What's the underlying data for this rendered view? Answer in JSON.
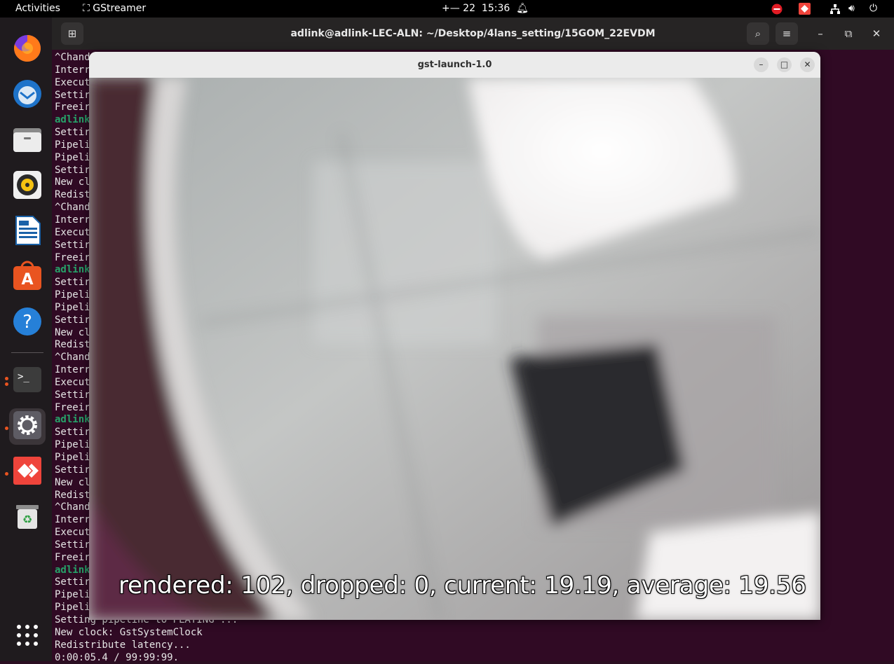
{
  "topbar": {
    "activities": "Activities",
    "app_name": "GStreamer",
    "clock_date": "+— 22",
    "clock_time": "15:36"
  },
  "dock": {
    "items": [
      {
        "name": "Firefox",
        "icon": "firefox-icon"
      },
      {
        "name": "Thunderbird",
        "icon": "thunderbird-icon"
      },
      {
        "name": "Files",
        "icon": "files-icon"
      },
      {
        "name": "Rhythmbox",
        "icon": "rhythmbox-icon"
      },
      {
        "name": "LibreOffice Writer",
        "icon": "writer-icon"
      },
      {
        "name": "Ubuntu Software",
        "icon": "software-icon"
      },
      {
        "name": "Help",
        "icon": "help-icon"
      },
      {
        "name": "Terminal",
        "icon": "terminal-icon"
      },
      {
        "name": "Settings",
        "icon": "settings-icon"
      },
      {
        "name": "AnyDesk",
        "icon": "anydesk-icon"
      },
      {
        "name": "Trash",
        "icon": "trash-icon"
      }
    ]
  },
  "terminal": {
    "title": "adlink@adlink-LEC-ALN: ~/Desktop/4lans_setting/15GOM_22EVDM",
    "truncated_lines": [
      "^Chand",
      "Interr",
      "Execut",
      "Settir",
      "Freeir",
      "adlink",
      "Settir",
      "Pipeli",
      "Pipeli",
      "Settir",
      "New cl",
      "Redist",
      "^Chand",
      "Interr",
      "Execut",
      "Settir",
      "Freeir",
      "adlink",
      "Settir",
      "Pipeli",
      "Pipeli",
      "Settir",
      "New cl",
      "Redist",
      "^Chand",
      "Interr",
      "Execut",
      "Settir",
      "Freeir",
      "adlink",
      "Settir",
      "Pipeli",
      "Pipeli",
      "Settir",
      "New cl",
      "Redist",
      "^Chand",
      "Interr",
      "Execut",
      "Settir",
      "Freeir",
      "adlink",
      "Settir",
      "Pipeli",
      "Pipeli"
    ],
    "full_lines": [
      "Setting pipeline to PLAYING ...",
      "New clock: GstSystemClock",
      "Redistribute latency...",
      "0:00:05.4 / 99:99:99."
    ]
  },
  "gst_window": {
    "title": "gst-launch-1.0",
    "overlay": "rendered: 102, dropped: 0, current: 19.19, average: 19.56"
  }
}
